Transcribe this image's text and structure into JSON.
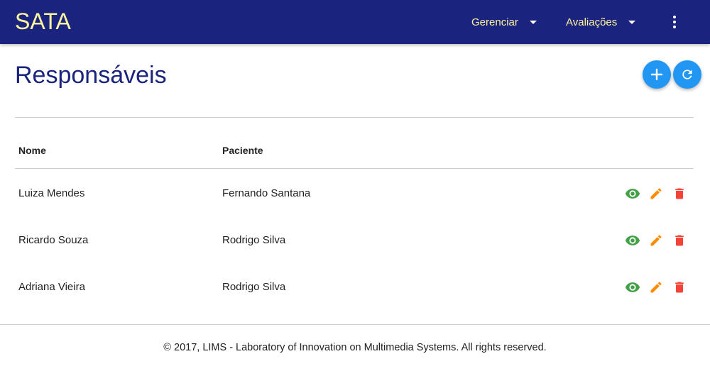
{
  "app": {
    "brand": "SATA"
  },
  "nav": {
    "menus": [
      {
        "label": "Gerenciar"
      },
      {
        "label": "Avaliações"
      }
    ],
    "more_icon": "more-vert-icon"
  },
  "page": {
    "title": "Responsáveis",
    "actions": [
      {
        "icon": "add-icon",
        "color": "#2196f3"
      },
      {
        "icon": "refresh-icon",
        "color": "#2196f3"
      }
    ]
  },
  "table": {
    "columns": [
      "Nome",
      "Paciente"
    ],
    "rows": [
      {
        "nome": "Luiza Mendes",
        "paciente": "Fernando Santana"
      },
      {
        "nome": "Ricardo Souza",
        "paciente": "Rodrigo Silva"
      },
      {
        "nome": "Adriana Vieira",
        "paciente": "Rodrigo Silva"
      }
    ],
    "row_actions": [
      {
        "icon": "eye-icon",
        "color": "#43a047"
      },
      {
        "icon": "pencil-icon",
        "color": "#fb8c00"
      },
      {
        "icon": "trash-icon",
        "color": "#f44336"
      }
    ]
  },
  "colors": {
    "navbar": "#1a237e",
    "brand_text": "#fff59d",
    "title": "#1a237e",
    "fab": "#2196f3"
  },
  "footer": {
    "text": "© 2017, LIMS - Laboratory of Innovation on Multimedia Systems. All rights reserved."
  }
}
